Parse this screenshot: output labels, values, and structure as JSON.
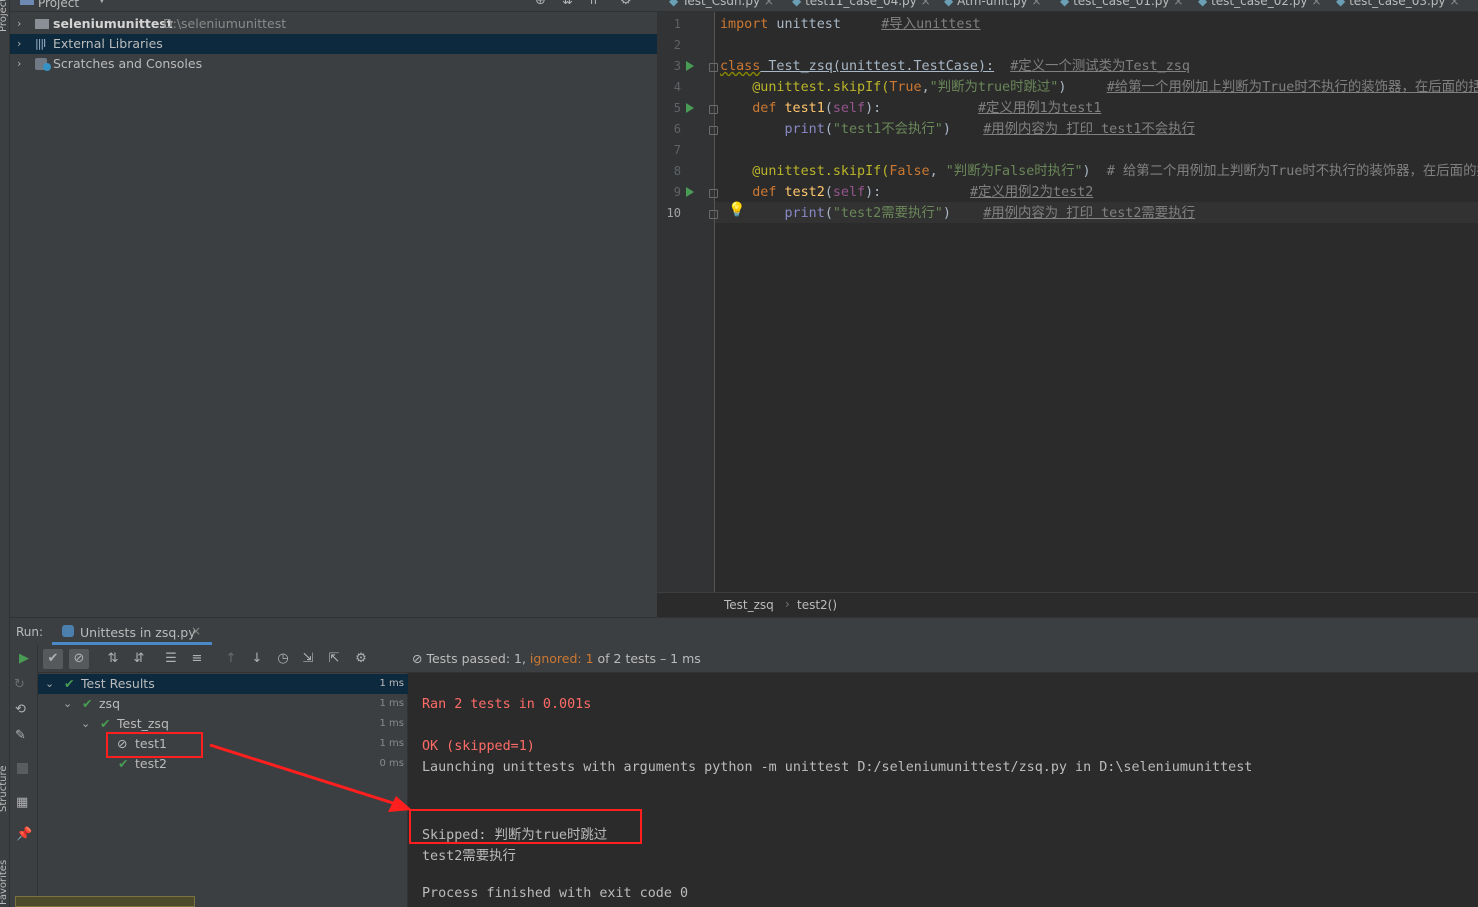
{
  "stripe": {
    "project_label": "Project",
    "structure_label": "Structure",
    "favorites_label": "Favorites"
  },
  "project": {
    "header_label": "Project",
    "items": [
      {
        "label": "seleniumunittest",
        "path": "D:\\seleniumunittest"
      },
      {
        "label": "External Libraries"
      },
      {
        "label": "Scratches and Consoles"
      }
    ]
  },
  "editor": {
    "tabs": [
      "Test_Csdn.py",
      "test11_case_04.py",
      "Atm-unit.py",
      "test_case_01.py",
      "test_case_02.py",
      "test_case_03.py"
    ],
    "line_numbers": [
      "1",
      "2",
      "3",
      "4",
      "5",
      "6",
      "7",
      "8",
      "9",
      "10"
    ],
    "code": {
      "l1_kw": "import",
      "l1_mod": " unittest",
      "l1_comment": "#导入unittest",
      "l3_kw": "class",
      "l3_name": " Test_zsq(unittest.TestCase):",
      "l3_comment": "#定义一个测试类为Test_zsq",
      "l4_dec": "@unittest.skipIf(",
      "l4_true": "True",
      "l4_str": "\"判断为true时跳过\"",
      "l4_close": ")",
      "l4_comment": "#给第一个用例加上判断为True时不执行的装饰器，在后面的括号",
      "l5_kw": "def",
      "l5_fn": " test1",
      "l5_self": "self",
      "l5_comment": "#定义用例1为test1",
      "l6_bi": "print",
      "l6_str": "\"test1不会执行\"",
      "l6_comment": "#用例内容为 打印 test1不会执行",
      "l8_dec": "@unittest.skipIf(",
      "l8_false": "False",
      "l8_str": "\"判断为False时执行\"",
      "l8_close": ")",
      "l8_comment": "# 给第二个用例加上判断为True时不执行的装饰器，在后面的括",
      "l9_kw": "def",
      "l9_fn": " test2",
      "l9_self": "self",
      "l9_comment": "#定义用例2为test2",
      "l10_bi": "print",
      "l10_str": "\"test2需要执行\"",
      "l10_comment": "#用例内容为 打印 test2需要执行"
    },
    "breadcrumb": [
      "Test_zsq",
      "test2()"
    ]
  },
  "run": {
    "label": "Run:",
    "config_tab": "Unittests in zsq.py",
    "status_passed": "Tests passed: 1,",
    "status_ignored": "ignored: 1",
    "status_rest": "of 2 tests – 1 ms",
    "tree": [
      {
        "label": "Test Results",
        "time": "1 ms"
      },
      {
        "label": "zsq",
        "time": "1 ms"
      },
      {
        "label": "Test_zsq",
        "time": "1 ms"
      },
      {
        "label": "test1",
        "time": "1 ms"
      },
      {
        "label": "test2",
        "time": "0 ms"
      }
    ],
    "console": {
      "line1": "Ran 2 tests in 0.001s",
      "line2": "OK (skipped=1)",
      "line3": "Launching unittests with arguments python -m unittest D:/seleniumunittest/zsq.py in D:\\seleniumunittest",
      "line4": "Skipped: 判断为true时跳过",
      "line5": "test2需要执行",
      "line6": "Process finished with exit code 0"
    }
  },
  "colors": {
    "accent_red": "#ff1f1f",
    "pass_green": "#499c54",
    "ignored_orange": "#cc7832",
    "console_red": "#ff6b68"
  }
}
